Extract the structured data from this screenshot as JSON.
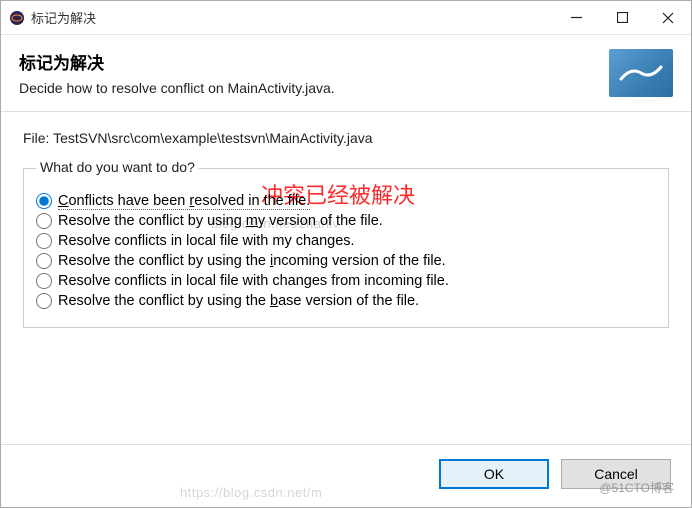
{
  "title": "标记为解决",
  "header": {
    "title": "标记为解决",
    "subtitle": "Decide how to resolve conflict on MainActivity.java."
  },
  "file_label": "File: TestSVN\\src\\com\\example\\testsvn\\MainActivity.java",
  "group_label": "What do you want to do?",
  "options": [
    "Conflicts have been resolved in the file.",
    "Resolve the conflict by using my version of the file.",
    "Resolve conflicts in local file with my changes.",
    "Resolve the conflict by using the incoming version of the file.",
    "Resolve conflicts in local file with changes from incoming file.",
    "Resolve the conflict by using the base version of the file."
  ],
  "annotation": "冲突已经被解决",
  "watermark": "blog.csdn.net/zhanlv",
  "watermark2": "https://blog.csdn.net/m",
  "tag": "@51CTO博客",
  "buttons": {
    "ok": "OK",
    "cancel": "Cancel"
  }
}
